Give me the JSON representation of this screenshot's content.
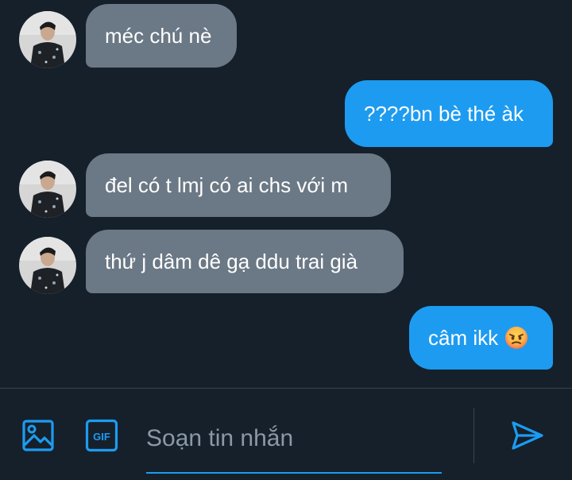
{
  "messages": [
    {
      "direction": "in",
      "text": "méc chú nè"
    },
    {
      "direction": "out",
      "text": "????bn bè thé àk"
    },
    {
      "direction": "in",
      "text": "đel có t lmj có ai chs với m"
    },
    {
      "direction": "in",
      "text": "thứ j dâm dê gạ ddu trai già"
    },
    {
      "direction": "out",
      "text": "câm ikk",
      "emoji": "angry-face"
    }
  ],
  "composer": {
    "placeholder": "Soạn tin nhắn",
    "icons": [
      "image-icon",
      "gif-icon",
      "send-icon"
    ],
    "gif_label": "GIF"
  },
  "colors": {
    "background": "#15202b",
    "incoming_bubble": "#6b7885",
    "outgoing_bubble": "#1d9bf0",
    "accent": "#1d9bf0"
  }
}
